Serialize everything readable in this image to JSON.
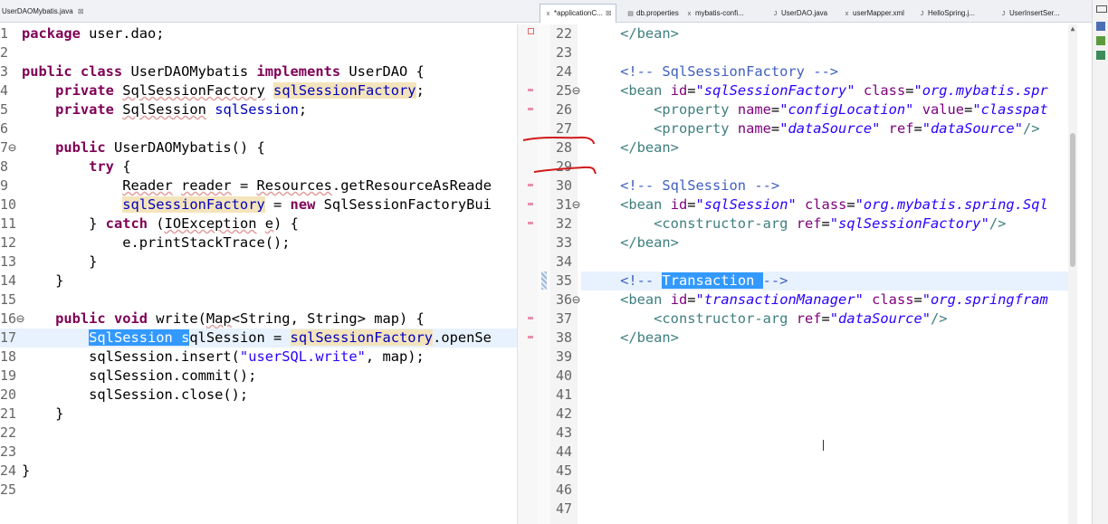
{
  "left_editor": {
    "tab": {
      "label": "UserDAOMybatis.java",
      "close": "⊠"
    },
    "lines": [
      {
        "n": "1",
        "html": "<span class='kw'>package</span> user.dao;"
      },
      {
        "n": "2",
        "html": ""
      },
      {
        "n": "3",
        "html": "<span class='kw'>public class</span> UserDAOMybatis <span class='kw'>implements</span> UserDAO {"
      },
      {
        "n": "4",
        "html": "    <span class='kw'>private</span> <span class='sq'>SqlSessionFactory</span> <span class='fld occ'>sqlSessionFactory</span>;"
      },
      {
        "n": "5",
        "html": "    <span class='kw'>private</span> <span class='sq'>SqlSession</span> <span class='fld'>sqlSession</span>;"
      },
      {
        "n": "6",
        "html": ""
      },
      {
        "n": "7⊖",
        "html": "    <span class='kw'>public</span> UserDAOMybatis() {"
      },
      {
        "n": "8",
        "html": "        <span class='kw'>try</span> {"
      },
      {
        "n": "9",
        "html": "            <span class='sq'>Reader</span> <span class='sq'>reader</span> = <span class='sq'>Resources</span>.getResourceAsReade"
      },
      {
        "n": "10",
        "html": "            <span class='fld occ'>sqlSessionFactory</span> = <span class='kw'>new</span> SqlSessionFactoryBui"
      },
      {
        "n": "11",
        "html": "        } <span class='kw'>catch</span> (<span class='sq'>IOException</span> <span class='sq'>e</span>) {"
      },
      {
        "n": "12",
        "html": "            e.printStackTrace();"
      },
      {
        "n": "13",
        "html": "        }"
      },
      {
        "n": "14",
        "html": "    }"
      },
      {
        "n": "15",
        "html": ""
      },
      {
        "n": "16⊖",
        "html": "    <span class='kw'>public void</span> write(<span class='sq'>Map</span>&lt;String, String&gt; map) {"
      },
      {
        "n": "17",
        "html": "        <span class='sel'>SqlSession s</span>qlSession = <span class='fld occ'>sqlSessionFactory</span>.openSe",
        "current": true
      },
      {
        "n": "18",
        "html": "        sqlSession.insert(<span class='str'>\"userSQL.write\"</span>, map);"
      },
      {
        "n": "19",
        "html": "        sqlSession.commit();"
      },
      {
        "n": "20",
        "html": "        sqlSession.close();"
      },
      {
        "n": "21",
        "html": "    }"
      },
      {
        "n": "22",
        "html": ""
      },
      {
        "n": "23",
        "html": ""
      },
      {
        "n": "24",
        "html": "}"
      },
      {
        "n": "25",
        "html": ""
      }
    ]
  },
  "right_editor": {
    "tabs": [
      {
        "label": "*applicationC...",
        "active": true,
        "icon": "x",
        "close": "⊠"
      },
      {
        "label": "db.properties",
        "icon": "▤"
      },
      {
        "label": "mybatis-confi...",
        "icon": "x"
      },
      {
        "label": "UserDAO.java",
        "icon": "J"
      },
      {
        "label": "userMapper.xml",
        "icon": "x"
      },
      {
        "label": "HelloSpring.j...",
        "icon": "J"
      },
      {
        "label": "UserInsertSer...",
        "icon": "J"
      }
    ],
    "lines": [
      {
        "n": "22",
        "html": "    <span class='xtag'>&lt;/bean&gt;</span>"
      },
      {
        "n": "23",
        "html": ""
      },
      {
        "n": "24",
        "html": "    <span class='xcmt'>&lt;!-- SqlSessionFactory --&gt;</span>"
      },
      {
        "n": "25⊖",
        "html": "    <span class='xtag'>&lt;bean</span> <span class='xattr'>id</span>=<span class='xval'>\"sqlSessionFactory\"</span> <span class='xattr'>class</span>=<span class='xval'>\"org.mybatis.spr</span>"
      },
      {
        "n": "26",
        "html": "        <span class='xtag'>&lt;property</span> <span class='xattr'>name</span>=<span class='xval'>\"configLocation\"</span> <span class='xattr'>value</span>=<span class='xval'>\"classpat</span>"
      },
      {
        "n": "27",
        "html": "        <span class='xtag'>&lt;property</span> <span class='xattr'>name</span>=<span class='xval'>\"dataSource\"</span> <span class='xattr'>ref</span>=<span class='xval'>\"dataSource\"</span><span class='xtag'>/&gt;</span>"
      },
      {
        "n": "28",
        "html": "    <span class='xtag'>&lt;/bean&gt;</span>"
      },
      {
        "n": "29",
        "html": ""
      },
      {
        "n": "30",
        "html": "    <span class='xcmt'>&lt;!-- SqlSession --&gt;</span>"
      },
      {
        "n": "31⊖",
        "html": "    <span class='xtag'>&lt;bean</span> <span class='xattr'>id</span>=<span class='xval'>\"sqlSession\"</span> <span class='xattr'>class</span>=<span class='xval'>\"org.mybatis.spring.Sql</span>"
      },
      {
        "n": "32",
        "html": "        <span class='xtag'>&lt;constructor-arg</span> <span class='xattr'>ref</span>=<span class='xval'>\"sqlSessionFactory\"</span><span class='xtag'>/&gt;</span>"
      },
      {
        "n": "33",
        "html": "    <span class='xtag'>&lt;/bean&gt;</span>"
      },
      {
        "n": "34",
        "html": ""
      },
      {
        "n": "35",
        "html": "    <span class='xcmt'>&lt;!-- </span><span class='sel'>Transaction </span><span class='xcmt'>--&gt;</span>",
        "current": true
      },
      {
        "n": "36⊖",
        "html": "    <span class='xtag'>&lt;bean</span> <span class='xattr'>id</span>=<span class='xval'>\"transactionManager\"</span> <span class='xattr'>class</span>=<span class='xval'>\"org.springfram</span>"
      },
      {
        "n": "37",
        "html": "        <span class='xtag'>&lt;constructor-arg</span> <span class='xattr'>ref</span>=<span class='xval'>\"dataSource\"</span><span class='xtag'>/&gt;</span>"
      },
      {
        "n": "38",
        "html": "    <span class='xtag'>&lt;/bean&gt;</span>"
      },
      {
        "n": "39",
        "html": ""
      },
      {
        "n": "40",
        "html": ""
      },
      {
        "n": "41",
        "html": ""
      },
      {
        "n": "42",
        "html": ""
      },
      {
        "n": "43",
        "html": ""
      },
      {
        "n": "44",
        "html": ""
      },
      {
        "n": "45",
        "html": ""
      },
      {
        "n": "46",
        "html": ""
      },
      {
        "n": "47",
        "html": ""
      }
    ]
  },
  "colors": {
    "current_line": "#e8f2fe",
    "selection": "#3399ff",
    "annotation_pen": "#d21a1a"
  }
}
